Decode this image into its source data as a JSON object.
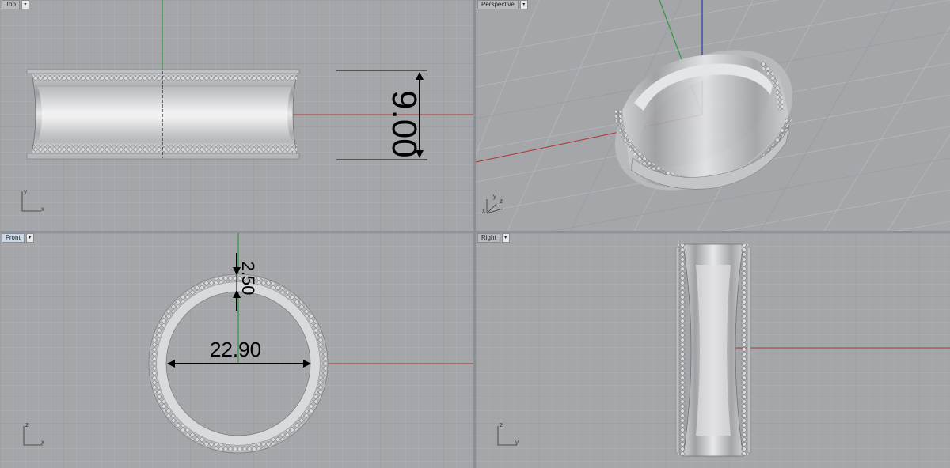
{
  "viewports": {
    "top": {
      "label": "Top",
      "axes": {
        "vertical": "y",
        "horizontal": "x"
      },
      "dimension": "9.00"
    },
    "perspective": {
      "label": "Perspective",
      "axes": {
        "a": "y",
        "b": "z",
        "c": "x"
      }
    },
    "front": {
      "label": "Front",
      "axes": {
        "vertical": "z",
        "horizontal": "x"
      },
      "dimension_thickness": "2.50",
      "dimension_diameter": "22.90"
    },
    "right": {
      "label": "Right",
      "axes": {
        "vertical": "z",
        "horizontal": "y"
      }
    }
  },
  "menu_glyph": "▾",
  "colors": {
    "viewport_bg": "#a4a6aa",
    "grid_line": "#b3b5b9",
    "grid_major": "#9a9ca0",
    "x_axis": "#b03030",
    "y_axis": "#2e9a3a",
    "z_axis": "#2e3aa0",
    "ring": "#c8c9cb"
  }
}
